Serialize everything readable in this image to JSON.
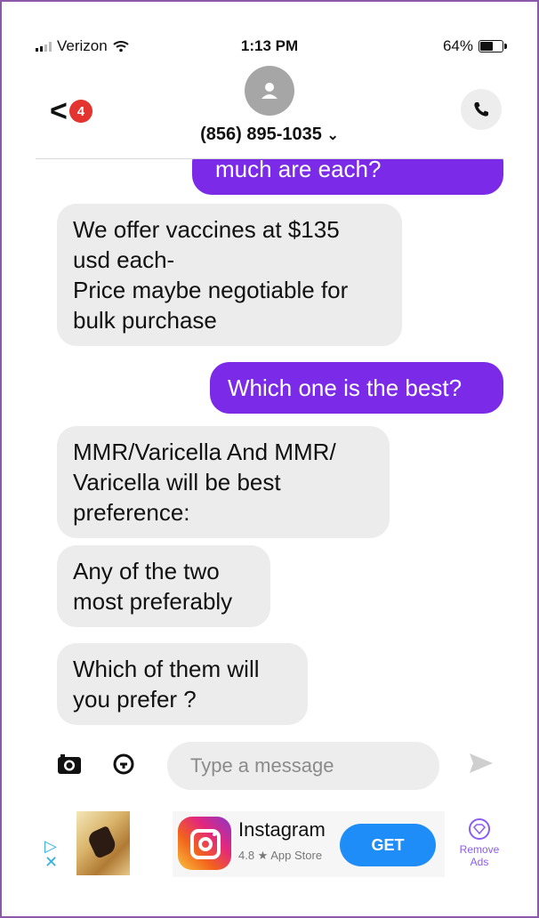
{
  "status_bar": {
    "carrier": "Verizon",
    "time": "1:13 PM",
    "battery": "64%",
    "battery_level": 0.64
  },
  "header": {
    "unread_count": "4",
    "contact": "(856) 895-1035",
    "contact_caret": "⌄"
  },
  "messages": [
    {
      "direction": "out",
      "text": "much are each?"
    },
    {
      "direction": "in",
      "text": "We offer vaccines at $135\nusd each-\nPrice maybe negotiable for\nbulk purchase"
    },
    {
      "direction": "out",
      "text": "Which one is the best?"
    },
    {
      "direction": "in",
      "text": "MMR/Varicella And MMR/\nVaricella will be best\npreference:"
    },
    {
      "direction": "in",
      "text": "Any of the two\nmost preferably"
    },
    {
      "direction": "in",
      "text": "Which of them will\nyou prefer ?"
    }
  ],
  "composer": {
    "placeholder": "Type a message"
  },
  "ad": {
    "app_name": "Instagram",
    "rating": "4.8 ★ App Store",
    "get_label": "GET",
    "remove_ads": "Remove\nAds"
  },
  "colors": {
    "outgoing": "#7b2ae8",
    "incoming": "#ececec",
    "get_button": "#1f8df7"
  },
  "icons": [
    "signal-icon",
    "wifi-icon",
    "battery-icon",
    "back-chevron-icon",
    "avatar-icon",
    "phone-icon",
    "camera-icon",
    "gif-icon",
    "send-icon",
    "adchoices-icon",
    "instagram-icon",
    "gem-icon"
  ]
}
